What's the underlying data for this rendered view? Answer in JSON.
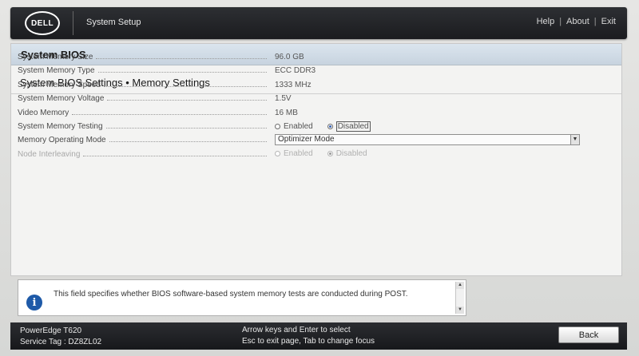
{
  "header": {
    "logo_text": "DELL",
    "app_title": "System Setup",
    "links": [
      "Help",
      "About",
      "Exit"
    ],
    "separator": "|"
  },
  "page": {
    "title": "System BIOS",
    "section_title": "System BIOS Settings • Memory Settings"
  },
  "settings": {
    "memory_size": {
      "label": "System Memory Size",
      "value": "96.0 GB"
    },
    "memory_type": {
      "label": "System Memory Type",
      "value": "ECC DDR3"
    },
    "memory_speed": {
      "label": "System Memory Speed",
      "value": "1333 MHz"
    },
    "memory_voltage": {
      "label": "System Memory Voltage",
      "value": "1.5V"
    },
    "video_memory": {
      "label": "Video Memory",
      "value": "16 MB"
    },
    "memory_testing": {
      "label": "System Memory Testing",
      "options": [
        "Enabled",
        "Disabled"
      ],
      "selected": "Disabled"
    },
    "operating_mode": {
      "label": "Memory Operating Mode",
      "value": "Optimizer Mode"
    },
    "node_interleaving": {
      "label": "Node Interleaving",
      "options": [
        "Enabled",
        "Disabled"
      ],
      "selected": "Disabled",
      "disabled": true
    }
  },
  "help": {
    "text": "This field specifies whether BIOS software-based system memory tests are conducted during POST."
  },
  "footer": {
    "model": "PowerEdge T620",
    "service_tag": "Service Tag : DZ8ZL02",
    "hint_line1": "Arrow keys and Enter to select",
    "hint_line2": "Esc to exit page, Tab to change focus",
    "back_label": "Back"
  },
  "colors": {
    "header_bg": "#1b1c1f",
    "page_header_bg": "#c7d3df",
    "radio_selected": "#3a62b0",
    "info_icon": "#1e5aa8"
  }
}
